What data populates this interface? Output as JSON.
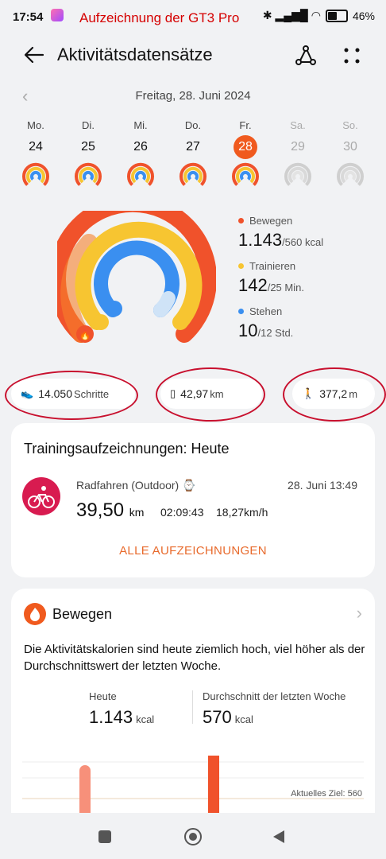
{
  "status": {
    "time": "17:54",
    "recording": "Aufzeichnung der GT3 Pro",
    "signal_icons": "✱ ▂▄▆█ ◠",
    "battery": "46%"
  },
  "header": {
    "title": "Aktivitätsdatensätze"
  },
  "date": {
    "label": "Freitag, 28. Juni 2024"
  },
  "days": [
    {
      "name": "Mo.",
      "num": "24",
      "state": "normal"
    },
    {
      "name": "Di.",
      "num": "25",
      "state": "normal"
    },
    {
      "name": "Mi.",
      "num": "26",
      "state": "normal"
    },
    {
      "name": "Do.",
      "num": "27",
      "state": "normal"
    },
    {
      "name": "Fr.",
      "num": "28",
      "state": "active"
    },
    {
      "name": "Sa.",
      "num": "29",
      "state": "muted"
    },
    {
      "name": "So.",
      "num": "30",
      "state": "muted"
    }
  ],
  "legend": {
    "move": {
      "label": "Bewegen",
      "value": "1.143",
      "goal": "/560 kcal",
      "color": "#f0522b"
    },
    "exercise": {
      "label": "Trainieren",
      "value": "142",
      "goal": "/25 Min.",
      "color": "#f7c531"
    },
    "stand": {
      "label": "Stehen",
      "value": "10",
      "goal": "/12 Std.",
      "color": "#3a8ff0"
    }
  },
  "stats": {
    "steps": {
      "value": "14.050",
      "unit": "Schritte"
    },
    "distance": {
      "value": "42,97",
      "unit": "km"
    },
    "climb": {
      "value": "377,2",
      "unit": "m"
    }
  },
  "records": {
    "title": "Trainingsaufzeichnungen: Heute",
    "activity": "Radfahren (Outdoor)",
    "datetime": "28. Juni 13:49",
    "distance": "39,50",
    "distance_unit": "km",
    "duration": "02:09:43",
    "speed": "18,27km/h",
    "all_link": "ALLE AUFZEICHNUNGEN"
  },
  "move_card": {
    "title": "Bewegen",
    "description": "Die Aktivitätskalorien sind heute ziemlich hoch, viel höher als der Durchschnittswert der letzten Woche.",
    "today_label": "Heute",
    "today_value": "1.143",
    "today_unit": "kcal",
    "avg_label": "Durchschnitt der letzten Woche",
    "avg_value": "570",
    "avg_unit": "kcal",
    "goal_label": "Aktuelles Ziel: 560"
  },
  "colors": {
    "accent": "#f05a1e",
    "move": "#f0522b",
    "exercise": "#f7c531",
    "stand": "#3a8ff0",
    "record": "#d81b50"
  }
}
